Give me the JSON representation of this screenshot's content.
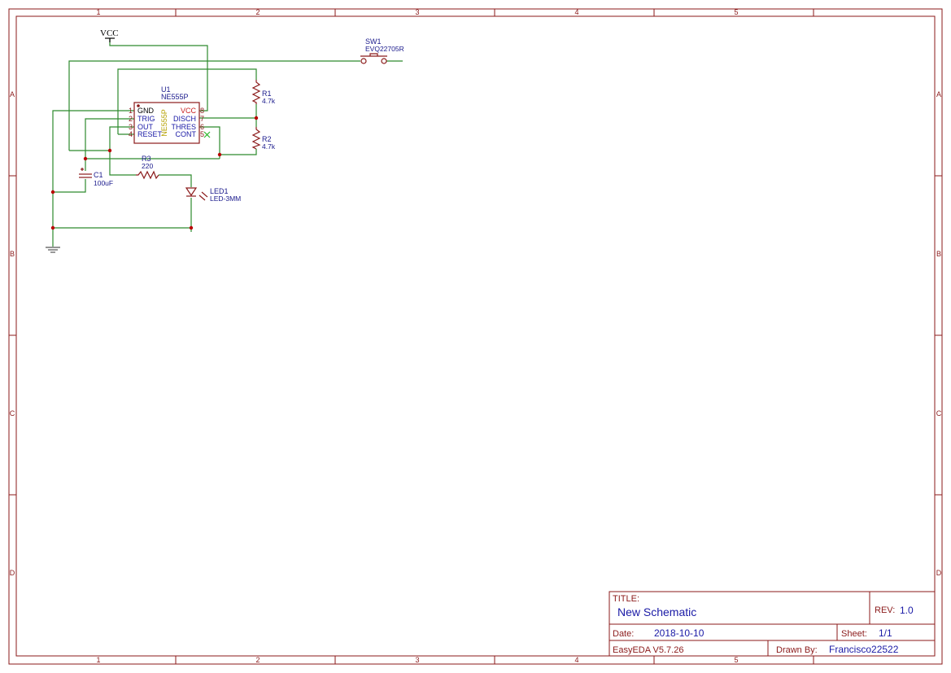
{
  "frame": {
    "columns": [
      "1",
      "2",
      "3",
      "4",
      "5"
    ],
    "rows": [
      "A",
      "B",
      "C",
      "D"
    ]
  },
  "title_block": {
    "title_label": "TITLE:",
    "title_value": "New Schematic",
    "rev_label": "REV:",
    "rev_value": "1.0",
    "date_label": "Date:",
    "date_value": "2018-10-10",
    "sheet_label": "Sheet:",
    "sheet_value": "1/1",
    "software": "EasyEDA V5.7.26",
    "drawn_by_label": "Drawn By:",
    "drawn_by_value": "Francisco22522"
  },
  "components": {
    "vcc": {
      "label": "VCC"
    },
    "sw1": {
      "designator": "SW1",
      "value": "EVQ22705R"
    },
    "u1": {
      "designator": "U1",
      "value": "NE555P",
      "body_label": "NE555P",
      "left_pins": [
        {
          "num": "1",
          "name": "GND"
        },
        {
          "num": "2",
          "name": "TRIG"
        },
        {
          "num": "3",
          "name": "OUT"
        },
        {
          "num": "4",
          "name": "RESET"
        }
      ],
      "right_pins": [
        {
          "num": "8",
          "name": "VCC"
        },
        {
          "num": "7",
          "name": "DISCH"
        },
        {
          "num": "6",
          "name": "THRES"
        },
        {
          "num": "5",
          "name": "CONT"
        }
      ]
    },
    "r1": {
      "designator": "R1",
      "value": "4.7k"
    },
    "r2": {
      "designator": "R2",
      "value": "4.7k"
    },
    "r3": {
      "designator": "R3",
      "value": "220"
    },
    "c1": {
      "designator": "C1",
      "value": "100uF"
    },
    "led1": {
      "designator": "LED1",
      "value": "LED-3MM"
    }
  },
  "colors": {
    "frame": "#8b1a1a",
    "wire": "#2d8a2d",
    "text_blue": "#1a1aa6",
    "junction": "#b80000"
  }
}
